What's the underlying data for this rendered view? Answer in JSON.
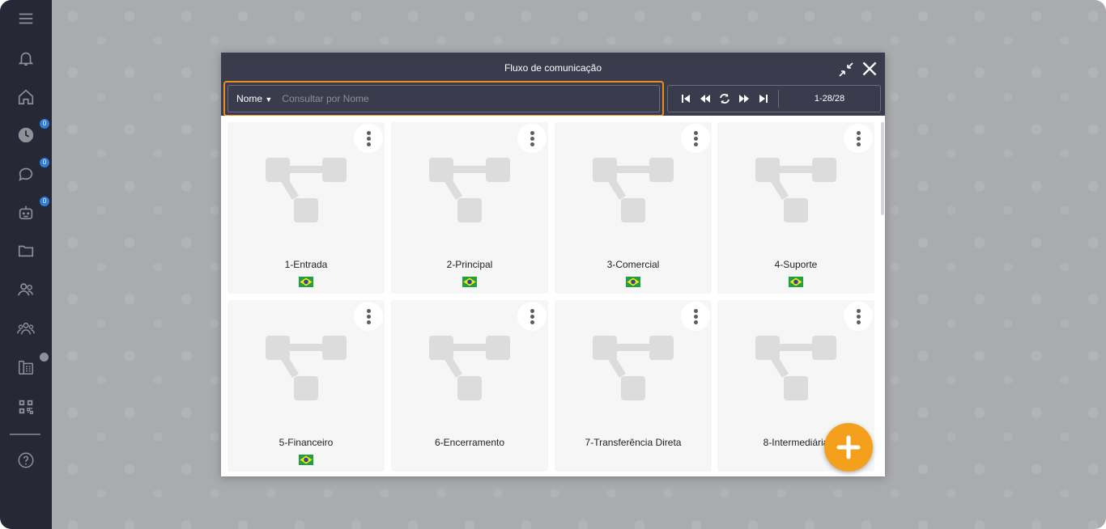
{
  "modal": {
    "title": "Fluxo de comunicação"
  },
  "search": {
    "field": "Nome",
    "placeholder": "Consultar por Nome"
  },
  "pager": {
    "range": "1-28/28"
  },
  "sidebar": {
    "badges": {
      "history": "0",
      "chat": "0",
      "bot": "0"
    },
    "icons": [
      "menu-icon",
      "bell-icon",
      "home-icon",
      "clock-icon",
      "chat-bubble-icon",
      "robot-icon",
      "folder-icon",
      "users-icon",
      "group-icon",
      "phone-directory-icon",
      "qr-code-icon",
      "help-icon"
    ]
  },
  "cards": [
    {
      "title": "1-Entrada",
      "flag": "brazil-flag-icon"
    },
    {
      "title": "2-Principal",
      "flag": "brazil-flag-icon"
    },
    {
      "title": "3-Comercial",
      "flag": "brazil-flag-icon"
    },
    {
      "title": "4-Suporte",
      "flag": "brazil-flag-icon"
    },
    {
      "title": "5-Financeiro",
      "flag": "brazil-flag-icon"
    },
    {
      "title": "6-Encerramento",
      "flag": ""
    },
    {
      "title": "7-Transferência Direta",
      "flag": ""
    },
    {
      "title": "8-Intermediária",
      "flag": ""
    }
  ],
  "colors": {
    "accent": "#f08c1a",
    "fab": "#f5a01c",
    "header": "#3a3c4e",
    "sidebar": "#262836",
    "badge": "#2f7fd8"
  }
}
